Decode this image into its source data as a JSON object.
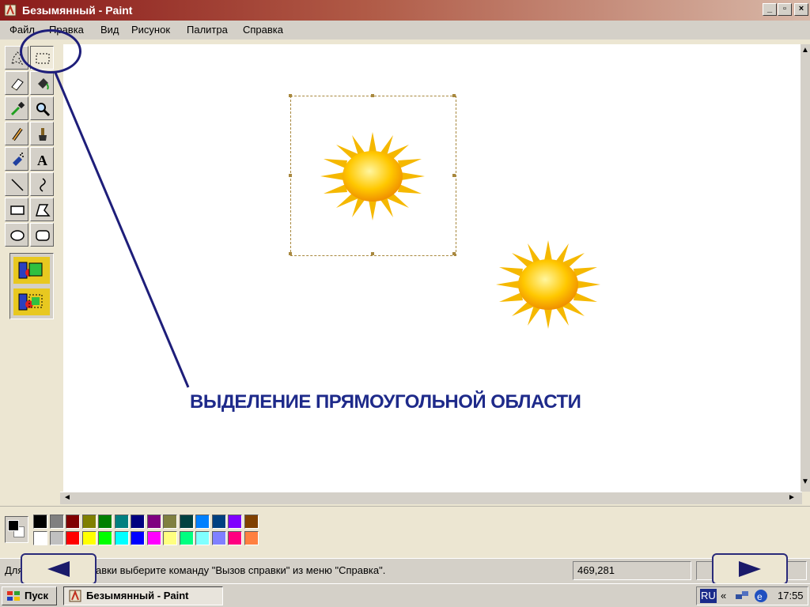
{
  "window": {
    "title": "Безымянный - Paint"
  },
  "menu": [
    {
      "id": "file",
      "label": "Файл"
    },
    {
      "id": "edit",
      "label": "Правка"
    },
    {
      "id": "view",
      "label": "Вид"
    },
    {
      "id": "image",
      "label": "Рисунок"
    },
    {
      "id": "palette",
      "label": "Палитра"
    },
    {
      "id": "help",
      "label": "Справка"
    }
  ],
  "tools": [
    {
      "name": "free-select-icon",
      "active": false
    },
    {
      "name": "rect-select-icon",
      "active": true
    },
    {
      "name": "eraser-icon",
      "active": false
    },
    {
      "name": "fill-bucket-icon",
      "active": false
    },
    {
      "name": "color-picker-icon",
      "active": false
    },
    {
      "name": "magnifier-icon",
      "active": false
    },
    {
      "name": "pencil-icon",
      "active": false
    },
    {
      "name": "brush-icon",
      "active": false
    },
    {
      "name": "airbrush-icon",
      "active": false
    },
    {
      "name": "text-icon",
      "active": false,
      "glyph": "A"
    },
    {
      "name": "line-icon",
      "active": false
    },
    {
      "name": "curve-icon",
      "active": false
    },
    {
      "name": "rectangle-icon",
      "active": false
    },
    {
      "name": "polygon-icon",
      "active": false
    },
    {
      "name": "ellipse-icon",
      "active": false
    },
    {
      "name": "rounded-rect-icon",
      "active": false
    }
  ],
  "selection_options": [
    {
      "name": "opaque-selection-icon",
      "selected": true
    },
    {
      "name": "transparent-selection-icon",
      "selected": true
    }
  ],
  "canvas": {
    "caption": "ВЫДЕЛЕНИЕ ПРЯМОУГОЛЬНОЙ ОБЛАСТИ"
  },
  "colors": {
    "foreground": "#000000",
    "background": "#ffffff",
    "accent": "#1e2a8a",
    "palette_top": [
      "#000000",
      "#808080",
      "#800000",
      "#808000",
      "#008000",
      "#008080",
      "#000080",
      "#800080",
      "#808040",
      "#004040",
      "#0080ff",
      "#004080",
      "#8000ff",
      "#804000"
    ],
    "palette_bottom": [
      "#ffffff",
      "#c0c0c0",
      "#ff0000",
      "#ffff00",
      "#00ff00",
      "#00ffff",
      "#0000ff",
      "#ff00ff",
      "#ffff80",
      "#00ff80",
      "#80ffff",
      "#8080ff",
      "#ff0080",
      "#ff8040"
    ]
  },
  "status": {
    "text": "Для получения справки выберите команду \"Вызов справки\" из меню \"Справка\".",
    "coords": "469,281"
  },
  "taskbar": {
    "start": "Пуск",
    "task": "Безымянный - Paint",
    "lang": "RU",
    "arrows": "«",
    "time": "17:55"
  }
}
